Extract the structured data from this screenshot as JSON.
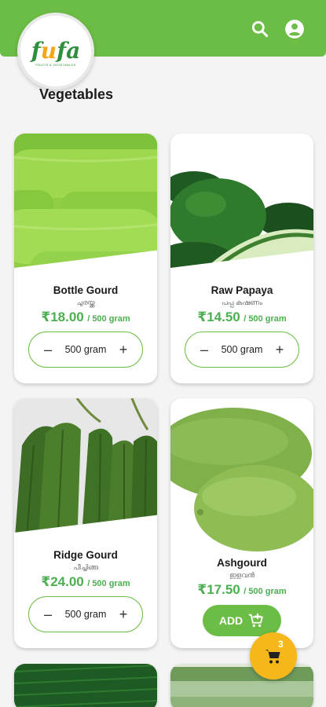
{
  "header": {
    "logo_text": "fufa",
    "logo_tagline": "FRUITS & VEGETABLES",
    "search_icon": "search-icon",
    "account_icon": "account-icon",
    "colors": {
      "brand_green": "#6cbd45",
      "accent_orange": "#f6b71a"
    }
  },
  "section": {
    "title": "Vegetables"
  },
  "products": [
    {
      "name": "Bottle Gourd",
      "native": "ചുരയ്ക്ക",
      "price": "₹18.00",
      "unit": "/ 500 gram",
      "qty": "500 gram",
      "minus": "–",
      "plus": "+"
    },
    {
      "name": "Raw Papaya",
      "native": "പപ്പ കഷണം",
      "price": "₹14.50",
      "unit": "/ 500 gram",
      "qty": "500 gram",
      "minus": "–",
      "plus": "+"
    },
    {
      "name": "Ridge Gourd",
      "native": "പീച്ചിങ്ങ",
      "price": "₹24.00",
      "unit": "/ 500 gram",
      "qty": "500 gram",
      "minus": "–",
      "plus": "+"
    },
    {
      "name": "Ashgourd",
      "native": "ഇളവൻ",
      "price": "₹17.50",
      "unit": "/ 500 gram",
      "add_label": "ADD"
    }
  ],
  "cart": {
    "count": "3",
    "icon": "cart-icon"
  }
}
